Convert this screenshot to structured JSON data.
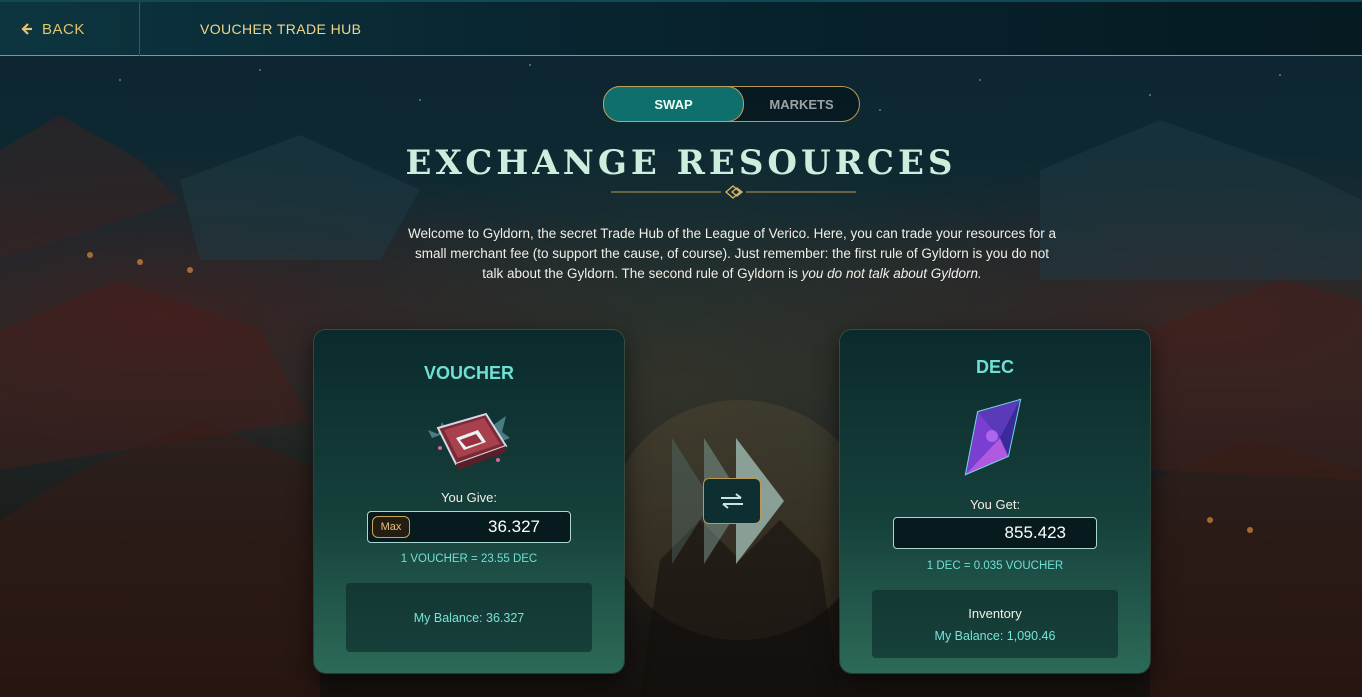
{
  "topbar": {
    "back_label": "BACK",
    "title": "VOUCHER TRADE HUB"
  },
  "tabs": [
    {
      "label": "SWAP",
      "active": true
    },
    {
      "label": "MARKETS",
      "active": false
    }
  ],
  "heading": "EXCHANGE RESOURCES",
  "intro": {
    "text": "Welcome to Gyldorn, the secret Trade Hub of the League of Verico. Here, you can trade your resources for a small merchant fee (to support the cause, of course). Just remember: the first rule of Gyldorn is you do not talk about the Gyldorn. The second rule of Gyldorn is ",
    "emphasis": "you do not talk about Gyldorn."
  },
  "give": {
    "title": "VOUCHER",
    "icon": "voucher-icon",
    "label": "You Give:",
    "max_label": "Max",
    "amount": "36.327",
    "rate": "1 VOUCHER = 23.55 DEC",
    "balance": "My Balance: 36.327"
  },
  "get": {
    "title": "DEC",
    "icon": "dec-crystal-icon",
    "label": "You Get:",
    "amount": "855.423",
    "rate": "1 DEC = 0.035 VOUCHER",
    "inventory_label": "Inventory",
    "balance": "My Balance: 1,090.46"
  },
  "colors": {
    "accent_teal": "#6fe0d4",
    "gold": "#e2c36e",
    "active_tab": "#0f6f6c"
  }
}
